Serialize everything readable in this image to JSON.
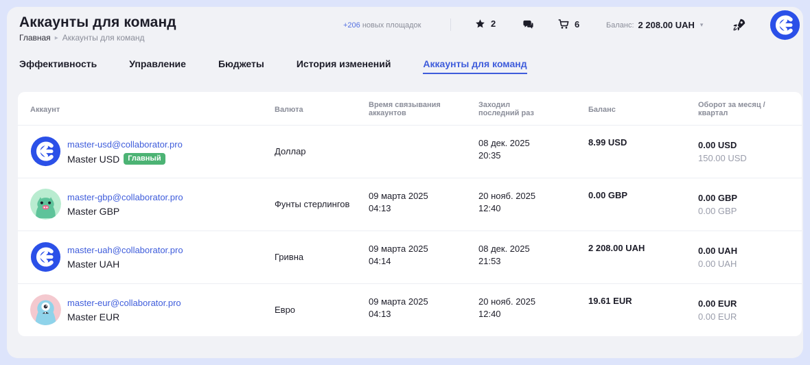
{
  "header": {
    "title": "Аккаунты для команд",
    "breadcrumb": [
      "Главная",
      "Аккаунты для команд"
    ],
    "new_sites_count": "+206",
    "new_sites_label": "новых площадок",
    "favorites_count": "2",
    "cart_count": "6",
    "balance_label": "Баланс:",
    "balance_value": "2 208.00 UAH"
  },
  "tabs": [
    {
      "label": "Эффективность",
      "active": false
    },
    {
      "label": "Управление",
      "active": false
    },
    {
      "label": "Бюджеты",
      "active": false
    },
    {
      "label": "История изменений",
      "active": false
    },
    {
      "label": "Аккаунты для команд",
      "active": true
    }
  ],
  "table": {
    "columns": {
      "account": "Аккаунт",
      "currency": "Валюта",
      "linked_time": [
        "Время связывания",
        "аккаунтов"
      ],
      "last_login": [
        "Заходил",
        "последний раз"
      ],
      "balance": "Баланс",
      "turnover": [
        "Оборот за месяц /",
        "квартал"
      ]
    },
    "rows": [
      {
        "avatar": "collaborator-logo",
        "email": "master-usd@collaborator.pro",
        "name": "Master USD",
        "badge": "Главный",
        "currency": "Доллар",
        "linked_date": "",
        "linked_time": "",
        "last_date": "08 дек. 2025",
        "last_time": "20:35",
        "balance": "8.99 USD",
        "turnover_month": "0.00 USD",
        "turnover_quarter": "150.00 USD"
      },
      {
        "avatar": "green-monster",
        "email": "master-gbp@collaborator.pro",
        "name": "Master GBP",
        "badge": "",
        "currency": "Фунты стерлингов",
        "linked_date": "09 марта 2025",
        "linked_time": "04:13",
        "last_date": "20 нояб. 2025",
        "last_time": "12:40",
        "balance": "0.00 GBP",
        "turnover_month": "0.00 GBP",
        "turnover_quarter": "0.00 GBP"
      },
      {
        "avatar": "collaborator-logo",
        "email": "master-uah@collaborator.pro",
        "name": "Master UAH",
        "badge": "",
        "currency": "Гривна",
        "linked_date": "09 марта 2025",
        "linked_time": "04:14",
        "last_date": "08 дек. 2025",
        "last_time": "21:53",
        "balance": "2 208.00 UAH",
        "turnover_month": "0.00 UAH",
        "turnover_quarter": "0.00 UAH"
      },
      {
        "avatar": "blue-monster",
        "email": "master-eur@collaborator.pro",
        "name": "Master EUR",
        "badge": "",
        "currency": "Евро",
        "linked_date": "09 марта 2025",
        "linked_time": "04:13",
        "last_date": "20 нояб. 2025",
        "last_time": "12:40",
        "balance": "19.61 EUR",
        "turnover_month": "0.00 EUR",
        "turnover_quarter": "0.00 EUR"
      }
    ]
  },
  "colors": {
    "accent": "#3e5cdb",
    "badge": "#4cb374",
    "background": "#f1f2f6"
  }
}
